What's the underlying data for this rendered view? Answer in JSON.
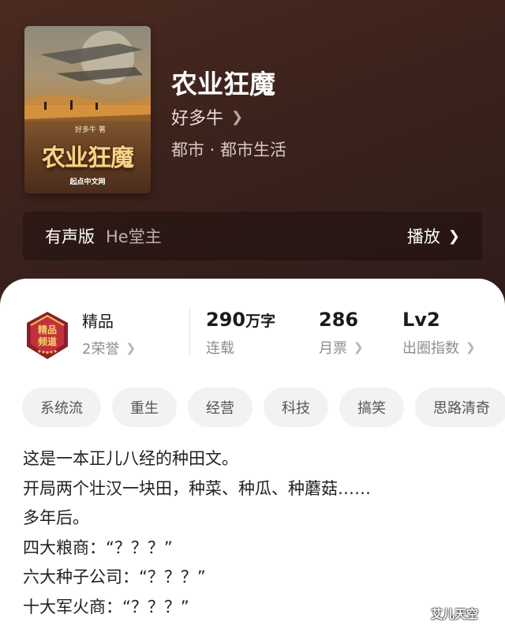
{
  "book": {
    "title": "农业狂魔",
    "author": "好多牛",
    "genre": "都市 · 都市生活",
    "cover": {
      "author_line": "好多牛 著",
      "title": "农业狂魔",
      "publisher": "起点中文网"
    }
  },
  "audio": {
    "label": "有声版",
    "narrator": "He堂主",
    "play_label": "播放"
  },
  "stats": {
    "badge": {
      "line1": "精品",
      "line2": "频道"
    },
    "quality": {
      "title": "精品",
      "sub": "2荣誉"
    },
    "words": {
      "value": "290",
      "unit": "万字",
      "sub": "连载"
    },
    "tickets": {
      "value": "286",
      "sub": "月票"
    },
    "level": {
      "value": "Lv2",
      "sub": "出圈指数"
    }
  },
  "tags": [
    "系统流",
    "重生",
    "经营",
    "科技",
    "搞笑",
    "思路清奇"
  ],
  "description": [
    "这是一本正儿八经的种田文。",
    "开局两个壮汉一块田，种菜、种瓜、种蘑菇……",
    "多年后。",
    "四大粮商：“？？？”",
    "六大种子公司：“？？？”",
    "十大军火商：“？？？”"
  ],
  "watermark": "艾儿天空",
  "colors": {
    "header_bg": "#3b221c",
    "badge_red": "#c0392b",
    "badge_gold": "#f2c14e"
  }
}
